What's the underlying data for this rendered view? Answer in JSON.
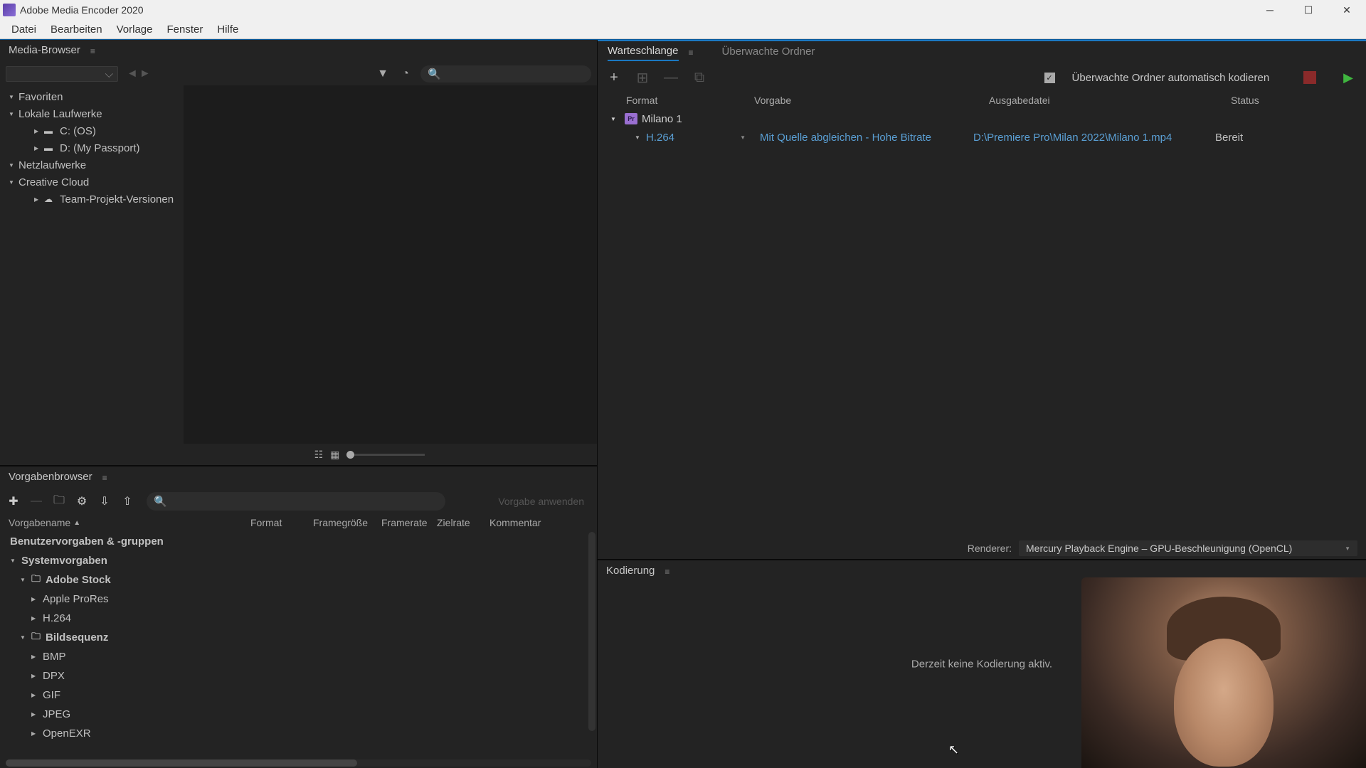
{
  "app": {
    "title": "Adobe Media Encoder 2020"
  },
  "menu": [
    "Datei",
    "Bearbeiten",
    "Vorlage",
    "Fenster",
    "Hilfe"
  ],
  "media_browser": {
    "title": "Media-Browser",
    "tree": {
      "favorites": "Favoriten",
      "local_drives": "Lokale Laufwerke",
      "drive_c": "C: (OS)",
      "drive_d": "D: (My Passport)",
      "network": "Netzlaufwerke",
      "creative_cloud": "Creative Cloud",
      "team_projects": "Team-Projekt-Versionen"
    }
  },
  "preset_browser": {
    "title": "Vorgabenbrowser",
    "apply_label": "Vorgabe anwenden",
    "headers": {
      "name": "Vorgabename",
      "format": "Format",
      "framesize": "Framegröße",
      "framerate": "Framerate",
      "bitrate": "Zielrate",
      "comment": "Kommentar"
    },
    "rows": {
      "user": "Benutzervorgaben & -gruppen",
      "system": "Systemvorgaben",
      "adobe_stock": "Adobe Stock",
      "apple_prores": "Apple ProRes",
      "h264": "H.264",
      "image_seq": "Bildsequenz",
      "bmp": "BMP",
      "dpx": "DPX",
      "gif": "GIF",
      "jpeg": "JPEG",
      "openexr": "OpenEXR"
    }
  },
  "queue": {
    "tab_queue": "Warteschlange",
    "tab_watch": "Überwachte Ordner",
    "auto_encode": "Überwachte Ordner automatisch kodieren",
    "headers": {
      "format": "Format",
      "preset": "Vorgabe",
      "output": "Ausgabedatei",
      "status": "Status"
    },
    "item": {
      "name": "Milano 1",
      "format": "H.264",
      "preset": "Mit Quelle abgleichen - Hohe Bitrate",
      "output": "D:\\Premiere Pro\\Milan 2022\\Milano 1.mp4",
      "status": "Bereit"
    },
    "renderer_label": "Renderer:",
    "renderer_value": "Mercury Playback Engine – GPU-Beschleunigung (OpenCL)"
  },
  "encoding": {
    "title": "Kodierung",
    "message": "Derzeit keine Kodierung aktiv."
  }
}
